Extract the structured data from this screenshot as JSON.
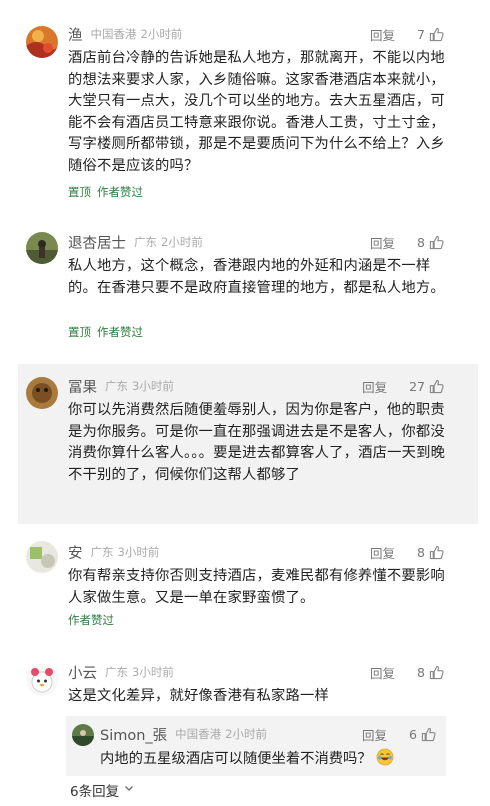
{
  "comments": [
    {
      "user": "渔",
      "region": "中国香港",
      "time": "2小时前",
      "reply_label": "回复",
      "likes": "7",
      "text": "酒店前台冷静的告诉她是私人地方，那就离开，不能以内地的想法来要求人家，入乡随俗嘛。这家香港酒店本来就小，大堂只有一点大，没几个可以坐的地方。去大五星酒店，可能不会有酒店员工特意来跟你说。香港人工贵，寸土寸金，写字楼厕所都带锁，那是不是要质问下为什么不给上？入乡随俗不是应该的吗？",
      "tags": [
        "置顶",
        "作者赞过"
      ]
    },
    {
      "user": "退杏居士",
      "region": "广东",
      "time": "2小时前",
      "reply_label": "回复",
      "likes": "8",
      "text": "私人地方，这个概念，香港跟内地的外延和内涵是不一样的。在香港只要不是政府直接管理的地方，都是私人地方。",
      "tags": [
        "置顶",
        "作者赞过"
      ]
    },
    {
      "user": "冨果",
      "region": "广东",
      "time": "3小时前",
      "reply_label": "回复",
      "likes": "27",
      "text": "你可以先消费然后随便羞辱别人，因为你是客户，他的职责是为你服务。可是你一直在那强调进去是不是客人，你都没消费你算什么客人。。。要是进去都算客人了，酒店一天到晚不干别的了，伺候你们这帮人都够了",
      "tags": []
    },
    {
      "user": "安",
      "region": "广东",
      "time": "3小时前",
      "reply_label": "回复",
      "likes": "8",
      "text": "你有帮亲支持你否则支持酒店，麦难民都有修养懂不要影响人家做生意。又是一单在家野蛮惯了。",
      "tags": [
        "作者赞过"
      ]
    },
    {
      "user": "小云",
      "region": "广东",
      "time": "3小时前",
      "reply_label": "回复",
      "likes": "8",
      "text": "这是文化差异，就好像香港有私家路一样",
      "tags": []
    }
  ],
  "sub_reply": {
    "user": "Simon_張",
    "region": "中国香港",
    "time": "2小时前",
    "reply_label": "回复",
    "likes": "6",
    "text": "内地的五星级酒店可以随便坐着不消费吗？",
    "emoji": "😂"
  },
  "more_replies_label": "6条回复",
  "colors": {
    "tag_green": "#2f7d42",
    "meta_gray": "#aaaaaa",
    "highlight_bg": "#f2f2f2"
  },
  "icons": {
    "like": "thumbs-up-icon",
    "expand": "chevron-down-icon"
  }
}
